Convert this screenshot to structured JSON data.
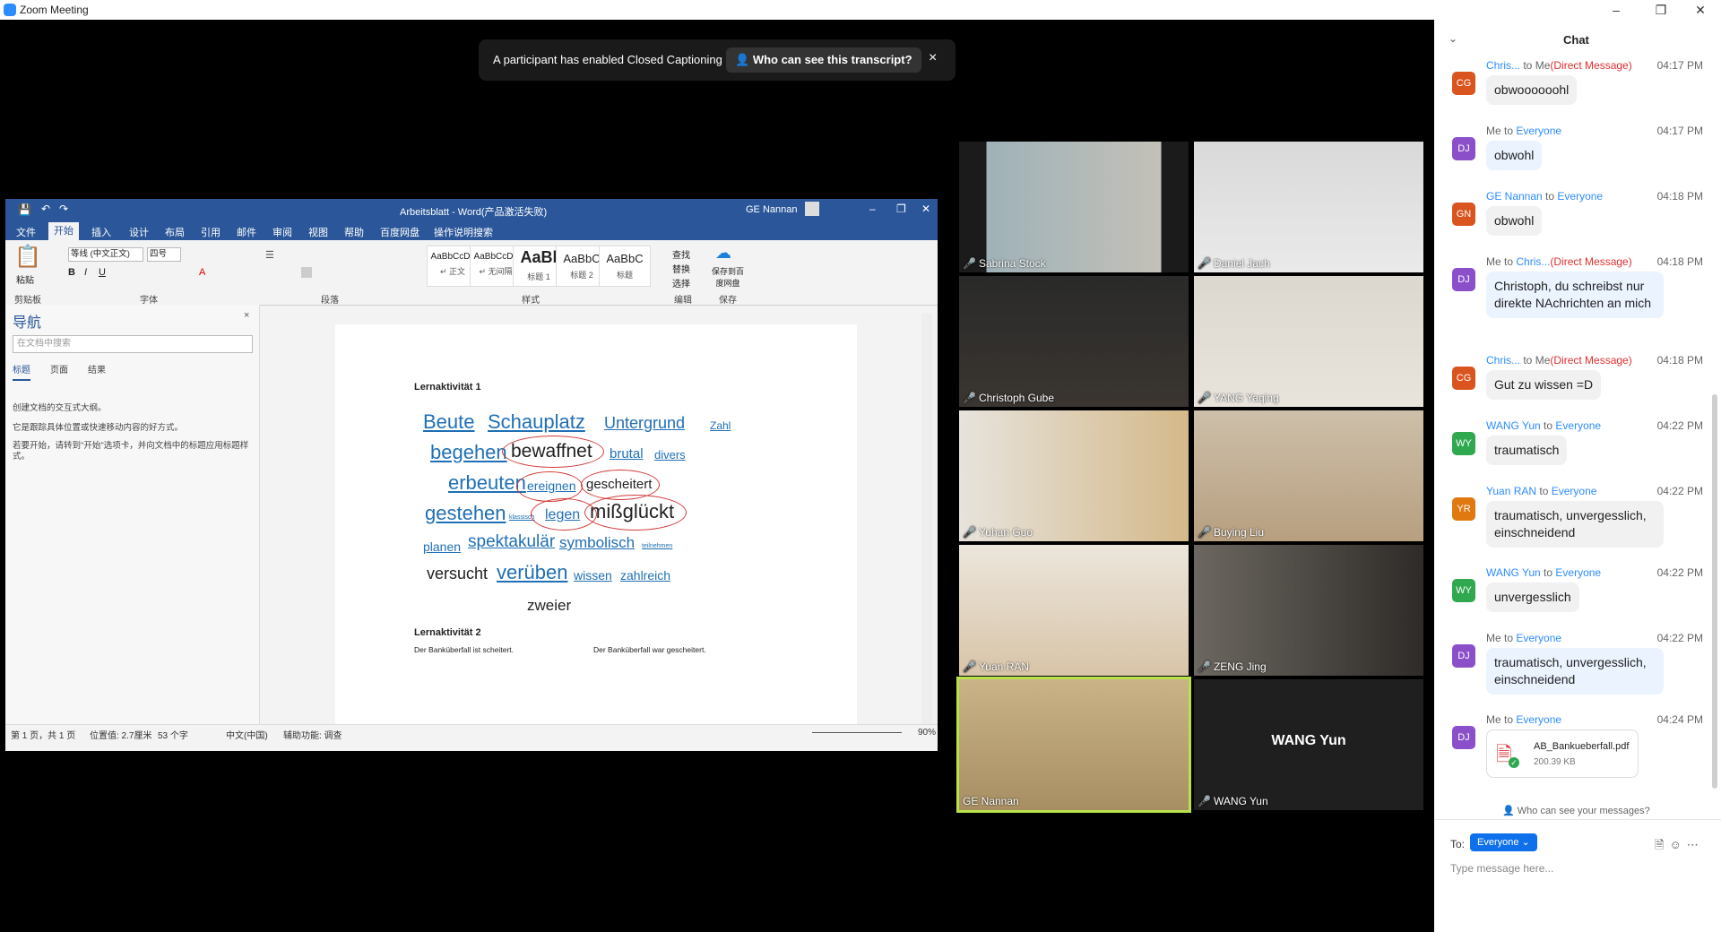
{
  "window": {
    "title": "Zoom Meeting",
    "controls": [
      "–",
      "❐",
      "✕"
    ]
  },
  "caption_banner": {
    "text": "A participant has enabled Closed Captioning",
    "who_button": "Who can see this transcript?",
    "close": "×"
  },
  "word": {
    "title": "Arbeitsblatt - Word(产品激活失败)",
    "user": "GE Nannan",
    "tabs": [
      "文件",
      "开始",
      "插入",
      "设计",
      "布局",
      "引用",
      "邮件",
      "审阅",
      "视图",
      "帮助",
      "百度网盘",
      "操作说明搜索"
    ],
    "ribbon": {
      "paste": "粘贴",
      "font_name": "等线 (中文正文)",
      "font_size": "四号",
      "styles": [
        {
          "preview": "AaBbCcDc",
          "name": "↵ 正文"
        },
        {
          "preview": "AaBbCcDc",
          "name": "↵ 无间隔"
        },
        {
          "preview": "AaBl",
          "name": "标题 1"
        },
        {
          "preview": "AaBbC",
          "name": "标题 2"
        },
        {
          "preview": "AaBbC",
          "name": "标题"
        }
      ],
      "find": "查找",
      "replace": "替换",
      "select": "选择",
      "save_baidu": "保存到百度网盘",
      "groups": [
        "剪贴板",
        "字体",
        "段落",
        "样式",
        "编辑",
        "保存"
      ]
    },
    "nav": {
      "title": "导航",
      "search_placeholder": "在文档中搜索",
      "tabs": [
        "标题",
        "页面",
        "结果"
      ],
      "hint1": "创建文档的交互式大纲。",
      "hint2": "它是跟踪具体位置或快速移动内容的好方式。",
      "hint3": "若要开始，请转到\"开始\"选项卡，并向文档中的标题应用标题样式。"
    },
    "page": {
      "heading1": "Lernaktivität 1",
      "cloud": {
        "beute": "Beute",
        "schauplatz": "Schauplatz",
        "untergrund": "Untergrund",
        "zahl": "Zahl",
        "begehen": "begehen",
        "bewaffnet": "bewaffnet",
        "brutal": "brutal",
        "divers": "divers",
        "erbeuten": "erbeuten",
        "ereignen": "ereignen",
        "gescheitert": "gescheitert",
        "gestehen": "gestehen",
        "klassisch": "klassisch",
        "legen": "legen",
        "missglueckt": "mißglückt",
        "planen": "planen",
        "spektakulaer": "spektakulär",
        "symbolisch": "symbolisch",
        "teilnehmen": "teilnehmen",
        "versucht": "versucht",
        "veruben": "verüben",
        "wissen": "wissen",
        "zahlreich": "zahlreich",
        "zweier": "zweier"
      },
      "heading2": "Lernaktivität 2",
      "line_left": "Der Banküberfall ist scheitert.",
      "line_right": "Der Banküberfall war gescheitert."
    },
    "status": {
      "page": "第 1 页，共 1 页",
      "position": "位置值: 2.7厘米",
      "words": "53 个字",
      "lang": "中文(中国)",
      "accessibility": "辅助功能: 调查",
      "zoom": "90%"
    }
  },
  "participants": [
    {
      "name": "Sabrina Stock",
      "muted": true
    },
    {
      "name": "Daniel Jach",
      "muted": true
    },
    {
      "name": "Christoph Gube",
      "muted": true
    },
    {
      "name": "YANG Yaqing",
      "muted": true
    },
    {
      "name": "Yuhan Guo",
      "muted": true
    },
    {
      "name": "Buying Liu",
      "muted": true
    },
    {
      "name": "Yuan RAN",
      "muted": true
    },
    {
      "name": "ZENG Jing",
      "muted": true
    },
    {
      "name": "GE Nannan",
      "muted": false,
      "speaking": true
    },
    {
      "name": "WANG Yun",
      "muted": true,
      "video_off": true,
      "display_name": "WANG Yun"
    }
  ],
  "chat": {
    "title": "Chat",
    "messages": [
      {
        "initials": "CG",
        "color": "#d9541e",
        "from": "Chris...",
        "to": "Me",
        "dm": "(Direct Message)",
        "time": "04:17 PM",
        "text": "obwoooooohl"
      },
      {
        "initials": "DJ",
        "color": "#8b4fc9",
        "from": "Me",
        "to": "Everyone",
        "time": "04:17 PM",
        "text": "obwohl"
      },
      {
        "initials": "GN",
        "color": "#d9541e",
        "from": "GE Nannan",
        "to": "Everyone",
        "time": "04:18 PM",
        "text": "obwohl"
      },
      {
        "initials": "DJ",
        "color": "#8b4fc9",
        "from": "Me",
        "to": "Chris...",
        "dm": "(Direct Message)",
        "time": "04:18 PM",
        "text": "Christoph, du schreibst nur direkte NAchrichten an mich"
      },
      {
        "initials": "CG",
        "color": "#d9541e",
        "from": "Chris...",
        "to": "Me",
        "dm": "(Direct Message)",
        "time": "04:18 PM",
        "text": "Gut zu wissen =D"
      },
      {
        "initials": "WY",
        "color": "#2fa84f",
        "from": "WANG Yun",
        "to": "Everyone",
        "time": "04:22 PM",
        "text": "traumatisch"
      },
      {
        "initials": "YR",
        "color": "#e07a10",
        "from": "Yuan RAN",
        "to": "Everyone",
        "time": "04:22 PM",
        "text": "traumatisch, unvergesslich, einschneidend"
      },
      {
        "initials": "WY",
        "color": "#2fa84f",
        "from": "WANG Yun",
        "to": "Everyone",
        "time": "04:22 PM",
        "text": "unvergesslich"
      },
      {
        "initials": "DJ",
        "color": "#8b4fc9",
        "from": "Me",
        "to": "Everyone",
        "time": "04:22 PM",
        "text": "traumatisch, unvergesslich, einschneidend"
      },
      {
        "initials": "DJ",
        "color": "#8b4fc9",
        "from": "Me",
        "to": "Everyone",
        "time": "04:24 PM",
        "file_name": "AB_Bankueberfall.pdf",
        "file_size": "200.39 KB"
      }
    ],
    "who_can_see": "Who can see your messages?",
    "to_label": "To:",
    "recipient": "Everyone",
    "input_placeholder": "Type message here..."
  }
}
